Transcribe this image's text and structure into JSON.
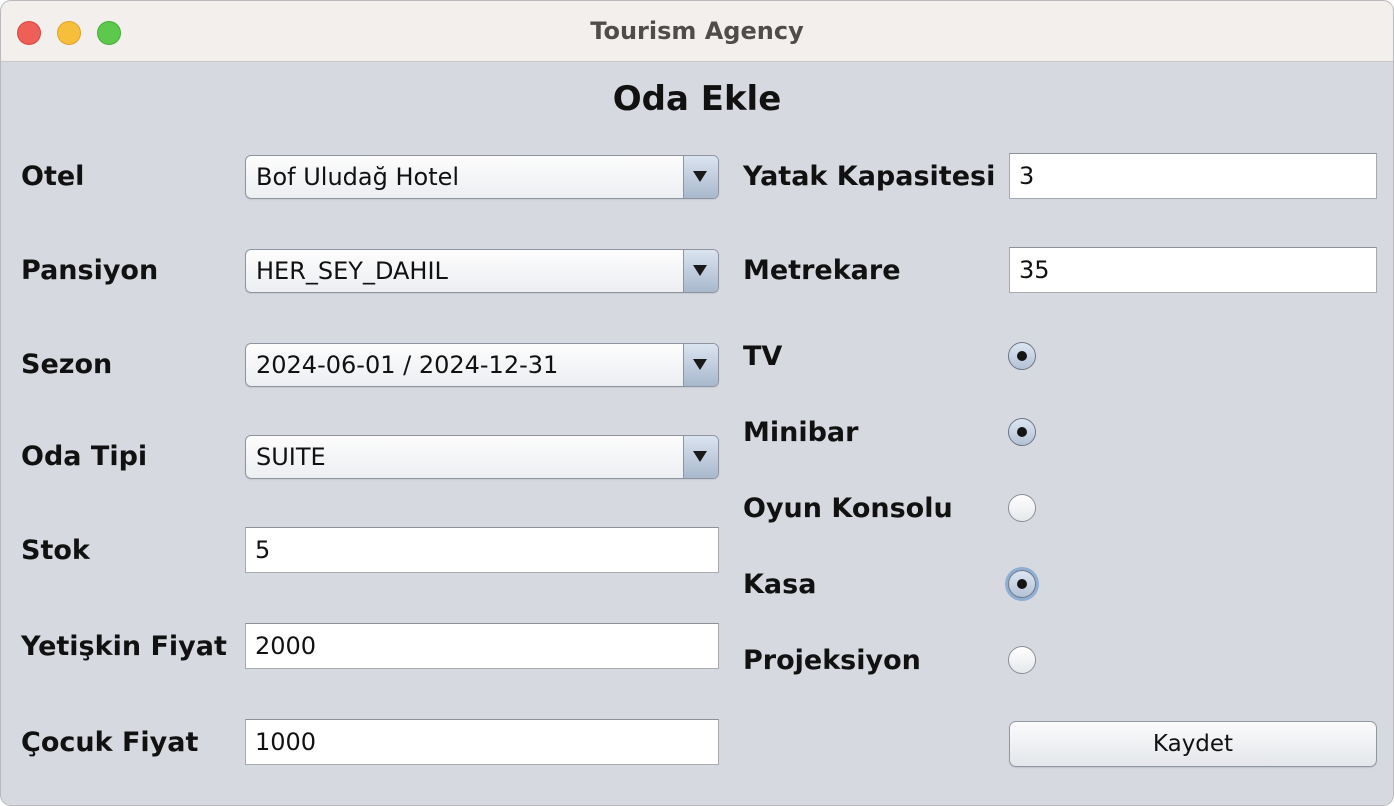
{
  "window": {
    "title": "Tourism Agency"
  },
  "heading": "Oda Ekle",
  "left": {
    "otel": {
      "label": "Otel",
      "value": "Bof Uludağ Hotel"
    },
    "pansiyon": {
      "label": "Pansiyon",
      "value": "HER_SEY_DAHIL"
    },
    "sezon": {
      "label": "Sezon",
      "value": "2024-06-01 / 2024-12-31"
    },
    "oda_tipi": {
      "label": "Oda Tipi",
      "value": "SUITE"
    },
    "stok": {
      "label": "Stok",
      "value": "5"
    },
    "yetiskin_fiyat": {
      "label": "Yetişkin Fiyat",
      "value": "2000"
    },
    "cocuk_fiyat": {
      "label": "Çocuk Fiyat",
      "value": "1000"
    }
  },
  "right": {
    "yatak_kapasitesi": {
      "label": "Yatak Kapasitesi",
      "value": "3"
    },
    "metrekare": {
      "label": "Metrekare",
      "value": "35"
    },
    "features": [
      {
        "label": "TV",
        "selected": true
      },
      {
        "label": "Minibar",
        "selected": true
      },
      {
        "label": "Oyun Konsolu",
        "selected": false
      },
      {
        "label": "Kasa",
        "selected": true
      },
      {
        "label": "Projeksiyon",
        "selected": false
      }
    ]
  },
  "save_button": "Kaydet",
  "icons": {
    "combo_arrow": "chevron-down-icon",
    "window_controls": [
      "close-icon",
      "minimize-icon",
      "maximize-icon"
    ]
  },
  "colors": {
    "window_bg": "#d6d9e0",
    "titlebar_bg": "#f3efec",
    "close": "#ee5f58",
    "minimize": "#f7be3b",
    "maximize": "#5dc84c",
    "focus_ring": "#8eaed2"
  }
}
